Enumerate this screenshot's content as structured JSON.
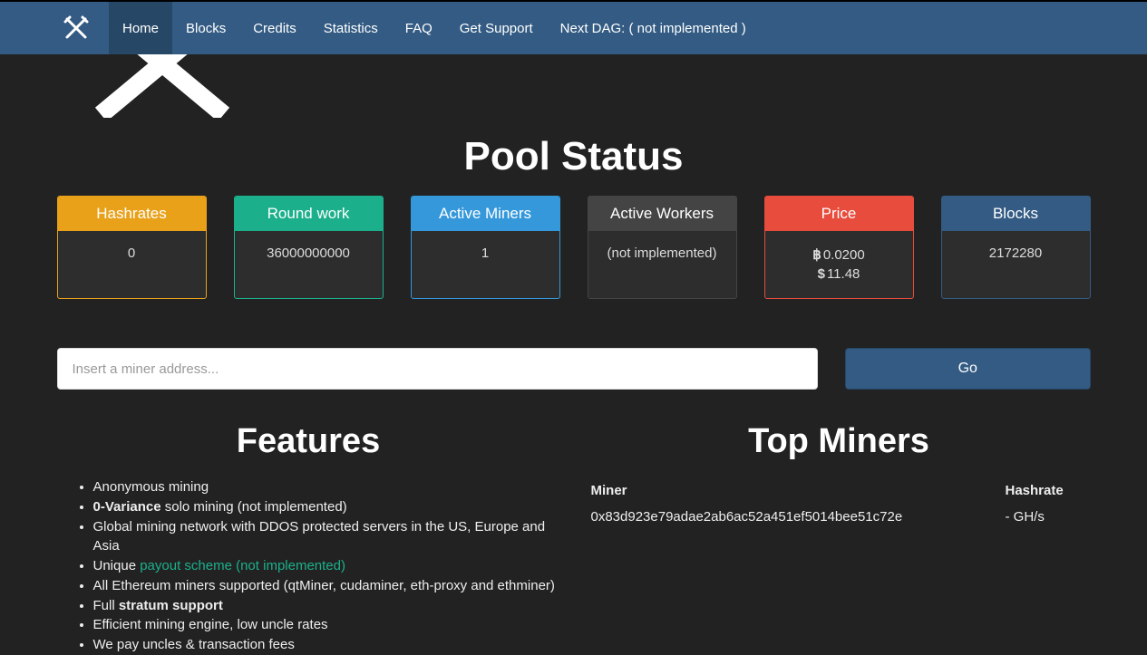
{
  "nav": {
    "items": [
      {
        "label": "Home",
        "active": true
      },
      {
        "label": "Blocks"
      },
      {
        "label": "Credits"
      },
      {
        "label": "Statistics"
      },
      {
        "label": "FAQ"
      },
      {
        "label": "Get Support"
      }
    ],
    "dag_text": "Next DAG: ( not implemented )"
  },
  "pool_status_title": "Pool Status",
  "stats": {
    "hashrates": {
      "title": "Hashrates",
      "value": "0"
    },
    "roundwork": {
      "title": "Round work",
      "value": "36000000000"
    },
    "miners": {
      "title": "Active Miners",
      "value": "1"
    },
    "workers": {
      "title": "Active Workers",
      "value": "(not implemented)"
    },
    "price": {
      "title": "Price",
      "btc": "0.0200",
      "usd": "11.48"
    },
    "blocks": {
      "title": "Blocks",
      "value": "2172280"
    }
  },
  "search": {
    "placeholder": "Insert a miner address...",
    "button": "Go"
  },
  "features": {
    "title": "Features",
    "f1": "Anonymous mining",
    "f2a": "0-Variance",
    "f2b": " solo mining (not implemented)",
    "f3": "Global mining network with DDOS protected servers in the US, Europe and Asia",
    "f4a": "Unique ",
    "f4b": "payout scheme (not implemented)",
    "f5": "All Ethereum miners supported (qtMiner, cudaminer, eth-proxy and ethminer)",
    "f6a": "Full ",
    "f6b": "stratum support",
    "f7": "Efficient mining engine, low uncle rates",
    "f8": "We pay uncles & transaction fees"
  },
  "top_miners": {
    "title": "Top Miners",
    "header_miner": "Miner",
    "header_hash": "Hashrate",
    "rows": [
      {
        "addr": "0x83d923e79adae2ab6ac52a451ef5014bee51c72e",
        "hash": "- GH/s"
      }
    ]
  }
}
